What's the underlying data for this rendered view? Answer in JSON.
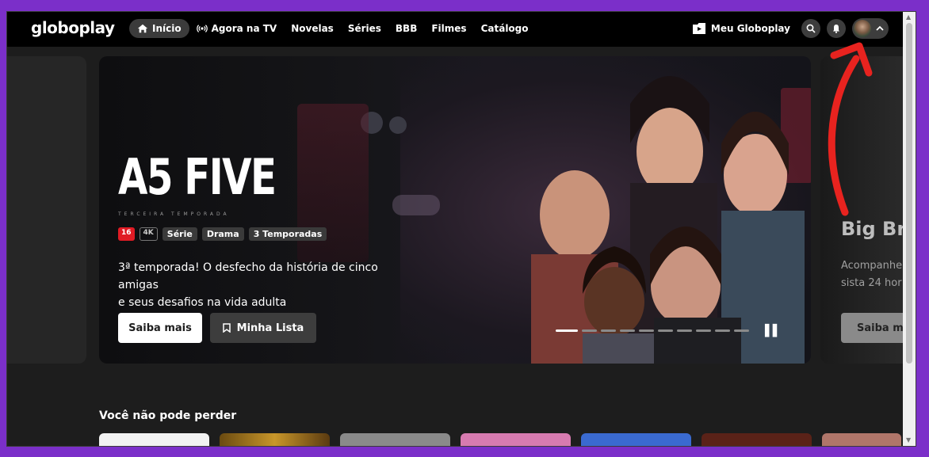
{
  "brand": {
    "logo": "globoplay"
  },
  "nav": {
    "items": [
      {
        "label": "Início",
        "icon": "home-icon",
        "active": true
      },
      {
        "label": "Agora na TV",
        "icon": "broadcast-icon",
        "active": false
      },
      {
        "label": "Novelas",
        "active": false
      },
      {
        "label": "Séries",
        "active": false
      },
      {
        "label": "BBB",
        "active": false
      },
      {
        "label": "Filmes",
        "active": false
      },
      {
        "label": "Catálogo",
        "active": false
      }
    ]
  },
  "header_right": {
    "meu_label": "Meu Globoplay",
    "icons": [
      "search-icon",
      "bell-icon",
      "avatar",
      "chevron-up-icon"
    ]
  },
  "hero": {
    "title": "A5 FIVE",
    "subtitle": "TERCEIRA TEMPORADA",
    "badges": {
      "age": "16",
      "quality": "4K",
      "type": "Série",
      "genre": "Drama",
      "seasons": "3 Temporadas"
    },
    "description_line1": "3ª temporada! O desfecho da história de cinco amigas",
    "description_line2": "e seus desafios na vida adulta",
    "primary_button": "Saiba mais",
    "secondary_button": "Minha Lista",
    "carousel": {
      "total": 10,
      "active_index": 0
    },
    "pause_icon": "pause-icon"
  },
  "next_hero": {
    "title": "Big Br",
    "desc_line1": "Acompanhe",
    "desc_line2": "sista 24 hor",
    "button": "Saiba ma"
  },
  "section": {
    "title": "Você não pode perder"
  },
  "colors": {
    "accent": "#e01b24",
    "annotation_arrow": "#e8231f",
    "background_frame": "#7b2fc9"
  }
}
